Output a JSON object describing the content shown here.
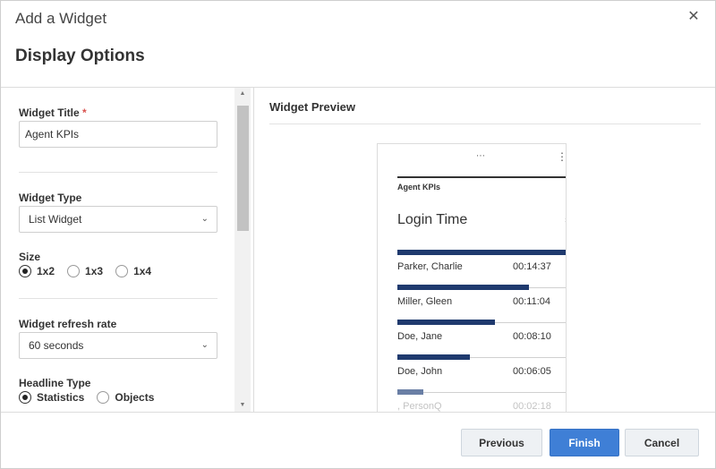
{
  "dialog": {
    "title": "Add a Widget",
    "close_glyph": "✕",
    "section_title": "Display Options"
  },
  "form": {
    "widget_title": {
      "label": "Widget Title",
      "required_mark": "*",
      "value": "Agent KPIs"
    },
    "widget_type": {
      "label": "Widget Type",
      "selected": "List Widget"
    },
    "size": {
      "label": "Size",
      "options": [
        "1x2",
        "1x3",
        "1x4"
      ],
      "selected": "1x2"
    },
    "refresh_rate": {
      "label": "Widget refresh rate",
      "selected": "60 seconds"
    },
    "headline_type": {
      "label": "Headline Type",
      "options": [
        "Statistics",
        "Objects"
      ],
      "selected": "Statistics"
    }
  },
  "preview": {
    "heading": "Widget Preview",
    "widget_name": "Agent KPIs",
    "metric_title": "Login Time",
    "rows": [
      {
        "name": "Parker, Charlie",
        "time": "00:14:37",
        "fraction": 1.0
      },
      {
        "name": "Miller, Gleen",
        "time": "00:11:04",
        "fraction": 0.76
      },
      {
        "name": "Doe, Jane",
        "time": "00:08:10",
        "fraction": 0.56
      },
      {
        "name": "Doe, John",
        "time": "00:06:05",
        "fraction": 0.42
      },
      {
        "name": ", PersonQ",
        "time": "00:02:18",
        "fraction": 0.15
      }
    ]
  },
  "footer": {
    "previous_label": "Previous",
    "finish_label": "Finish",
    "cancel_label": "Cancel"
  },
  "colors": {
    "bar": "#1f3a6e",
    "primary_button": "#3f7fd6",
    "required": "#d9534f"
  },
  "icons": {
    "close": "close-icon",
    "chevron": "chevron-down-icon",
    "drag": "drag-handle-icon",
    "menu": "kebab-menu-icon",
    "sort": "sort-icon"
  }
}
